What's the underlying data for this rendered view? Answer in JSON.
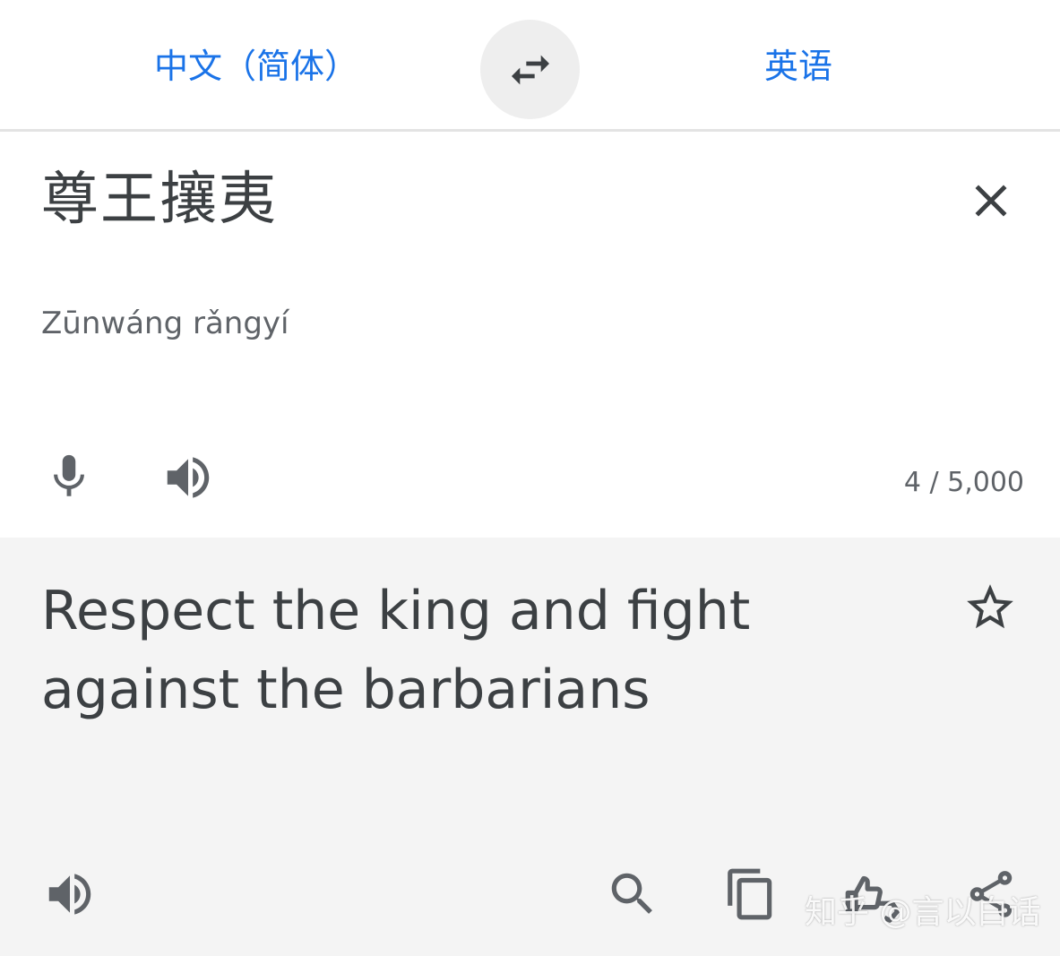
{
  "header": {
    "source_language": "中文（简体）",
    "target_language": "英语"
  },
  "source": {
    "text": "尊王攘夷",
    "transliteration": "Zūnwáng rǎngyí",
    "char_count": "4 / 5,000"
  },
  "result": {
    "text": "Respect the king and fight against the barbarians"
  },
  "watermark": "知乎 @言以白话",
  "colors": {
    "accent": "#1a73e8",
    "text": "#3c4043",
    "icon": "#5f6368",
    "result_bg": "#f4f4f4",
    "swap_bg": "#eeeeee"
  },
  "icons": [
    "swap-icon",
    "close-icon",
    "microphone-icon",
    "speaker-icon",
    "star-icon",
    "search-icon",
    "copy-icon",
    "feedback-icon",
    "share-icon"
  ]
}
